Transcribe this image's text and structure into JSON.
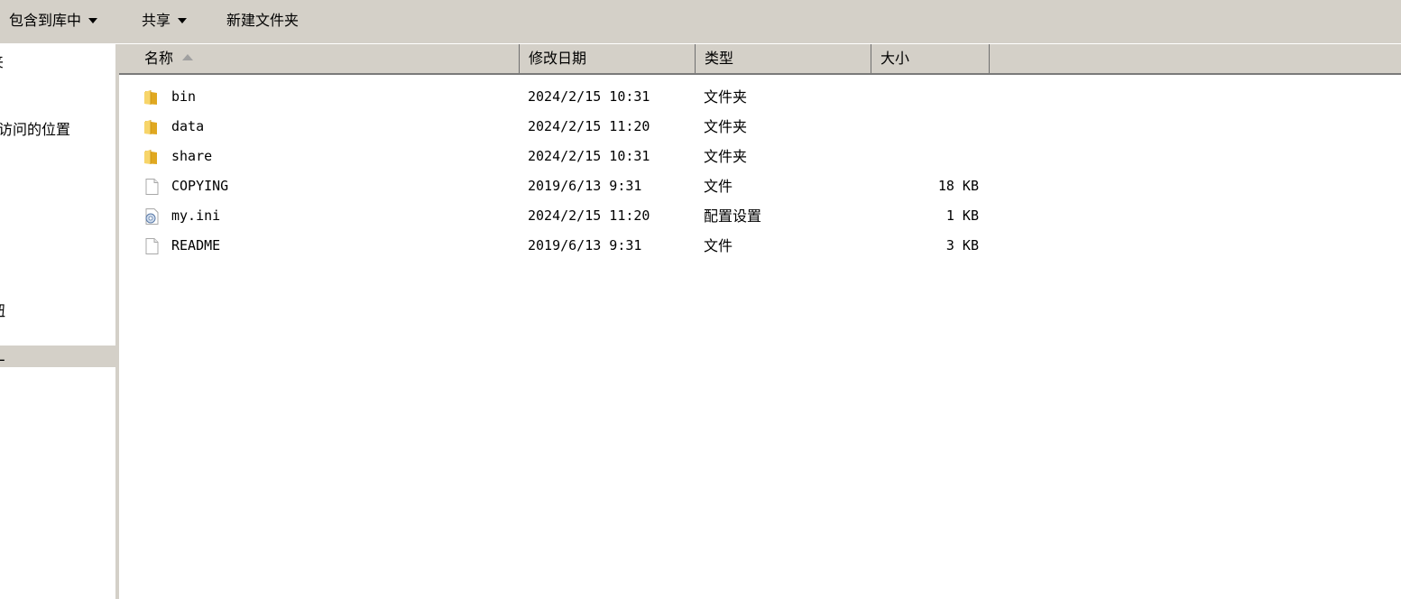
{
  "toolbar": {
    "include_in_library": "包含到库中",
    "share": "共享",
    "new_folder": "新建文件夹"
  },
  "nav": {
    "items": [
      {
        "label": "夹"
      },
      {
        "label": "访问的位置"
      },
      {
        "label": "钮"
      },
      {
        "label": "L"
      }
    ]
  },
  "columns": {
    "name": "名称",
    "modified": "修改日期",
    "type": "类型",
    "size": "大小"
  },
  "files": [
    {
      "name": "bin",
      "modified": "2024/2/15 10:31",
      "type": "文件夹",
      "size": "",
      "icon": "folder-icon"
    },
    {
      "name": "data",
      "modified": "2024/2/15 11:20",
      "type": "文件夹",
      "size": "",
      "icon": "folder-icon"
    },
    {
      "name": "share",
      "modified": "2024/2/15 10:31",
      "type": "文件夹",
      "size": "",
      "icon": "folder-icon"
    },
    {
      "name": "COPYING",
      "modified": "2019/6/13 9:31",
      "type": "文件",
      "size": "18 KB",
      "icon": "file-icon"
    },
    {
      "name": "my.ini",
      "modified": "2024/2/15 11:20",
      "type": "配置设置",
      "size": "1 KB",
      "icon": "settings-file-icon"
    },
    {
      "name": "README",
      "modified": "2019/6/13 9:31",
      "type": "文件",
      "size": "3 KB",
      "icon": "file-icon"
    }
  ],
  "colors": {
    "chrome": "#d4d0c8",
    "folder": "#f2c94c"
  }
}
